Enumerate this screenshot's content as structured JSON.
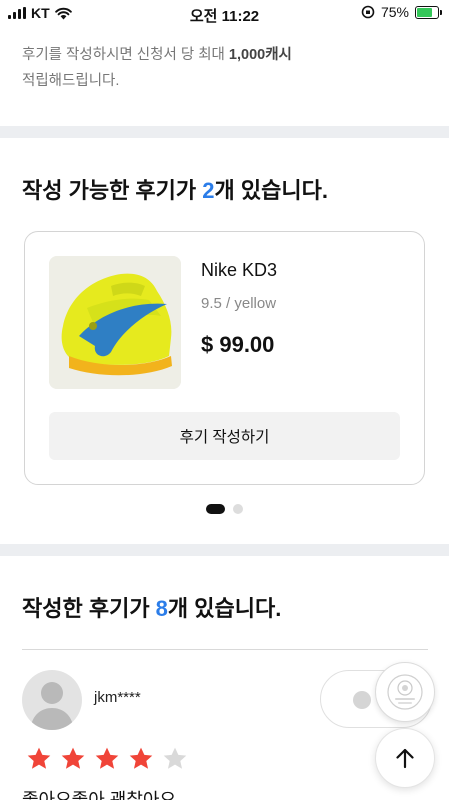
{
  "status_bar": {
    "carrier": "KT",
    "time": "오전 11:22",
    "battery_percent": "75%",
    "battery_level": 0.75
  },
  "notice": {
    "text_before": "후기를 작성하시면 신청서 당 최대 ",
    "highlight": "1,000캐시",
    "text_after": "적립해드립니다."
  },
  "available": {
    "title_before": "작성 가능한 후기가 ",
    "count": "2",
    "title_after": "개 있습니다.",
    "product": {
      "image_icon": "yellow-sneaker-image",
      "name": "Nike KD3",
      "option": "9.5 / yellow",
      "price": "$ 99.00",
      "write_button": "후기 작성하기"
    },
    "pagination": {
      "total": 2,
      "active": 1
    }
  },
  "written": {
    "title_before": "작성한 후기가 ",
    "count": "8",
    "title_after": "개 있습니다.",
    "review": {
      "username": "jkm****",
      "rating": 4,
      "max_rating": 5,
      "text": "좋아요좋아 괜찮아요"
    }
  },
  "colors": {
    "accent": "#2b7de9",
    "star_filled": "#f04438",
    "star_empty": "#d9d9d9",
    "band": "#eceef1"
  }
}
